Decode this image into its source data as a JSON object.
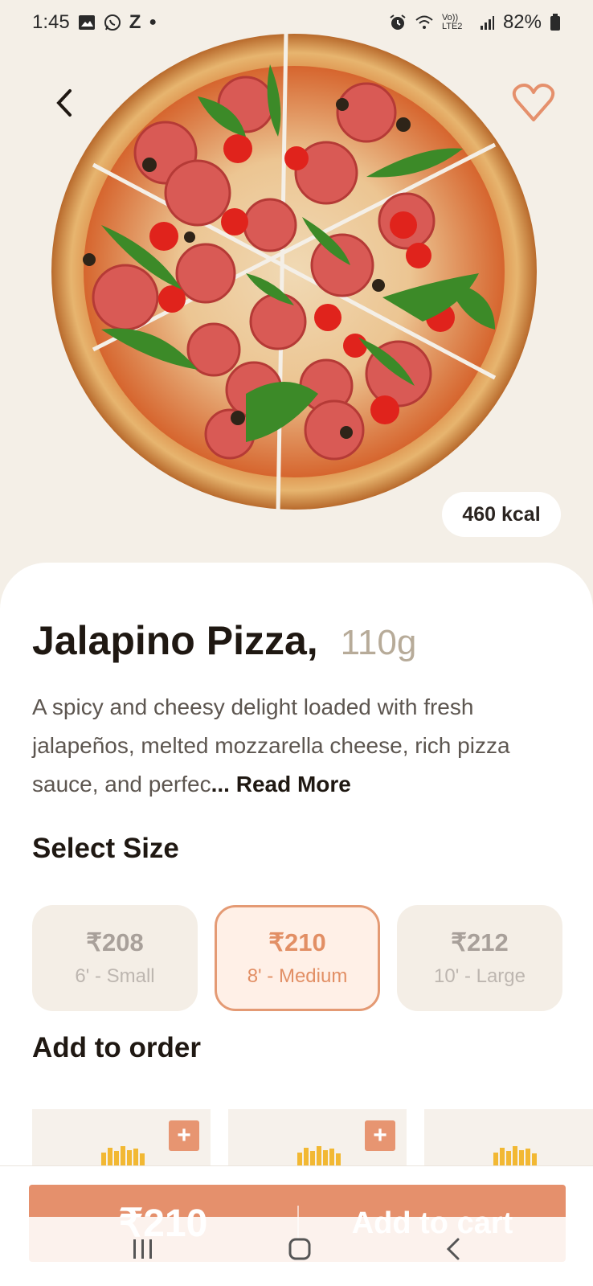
{
  "status_bar": {
    "time": "1:45",
    "carrier_letter": "Z",
    "network": "Vo)) LTE2",
    "battery": "82%"
  },
  "hero": {
    "kcal": "460 kcal",
    "icons": [
      "back-chevron-icon",
      "heart-outline-icon"
    ],
    "accent": "#e5906c"
  },
  "product": {
    "name": "Jalapino Pizza,",
    "weight": "110g",
    "description": "A spicy and cheesy delight loaded with fresh jalapeños, melted mozzarella cheese, rich pizza sauce, and perfec",
    "ellipsis": "...",
    "read_more": "Read More"
  },
  "sizes": {
    "heading": "Select Size",
    "options": [
      {
        "price": "₹208",
        "label": "6' - Small",
        "selected": false
      },
      {
        "price": "₹210",
        "label": "8' - Medium",
        "selected": true
      },
      {
        "price": "₹212",
        "label": "10' - Large",
        "selected": false
      }
    ]
  },
  "addons": {
    "heading": "Add to order",
    "plus": "+",
    "items": [
      {},
      {},
      {}
    ]
  },
  "cart": {
    "price": "₹210",
    "label": "Add to cart"
  },
  "navbar": {
    "icons": [
      "recent-apps-icon",
      "home-icon",
      "back-icon"
    ]
  }
}
